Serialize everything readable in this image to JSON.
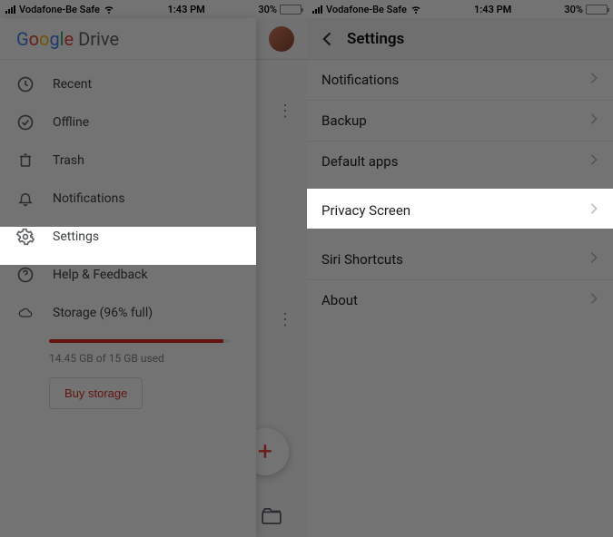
{
  "statusbar": {
    "carrier": "Vodafone-Be Safe",
    "time": "1:43 PM",
    "battery_pct": "30%"
  },
  "left": {
    "app_name_first": "G",
    "app_name_rest": "oogle",
    "drive_word": " Drive",
    "menu": {
      "recent": "Recent",
      "offline": "Offline",
      "trash": "Trash",
      "notifications": "Notifications",
      "settings": "Settings",
      "help": "Help & Feedback",
      "storage": "Storage (96% full)"
    },
    "storage_detail": "14.45 GB of 15 GB used",
    "buy_label": "Buy storage"
  },
  "right": {
    "title": "Settings",
    "rows": {
      "notifications": "Notifications",
      "backup": "Backup",
      "default_apps": "Default apps",
      "privacy_screen": "Privacy Screen",
      "siri": "Siri Shortcuts",
      "about": "About"
    }
  }
}
